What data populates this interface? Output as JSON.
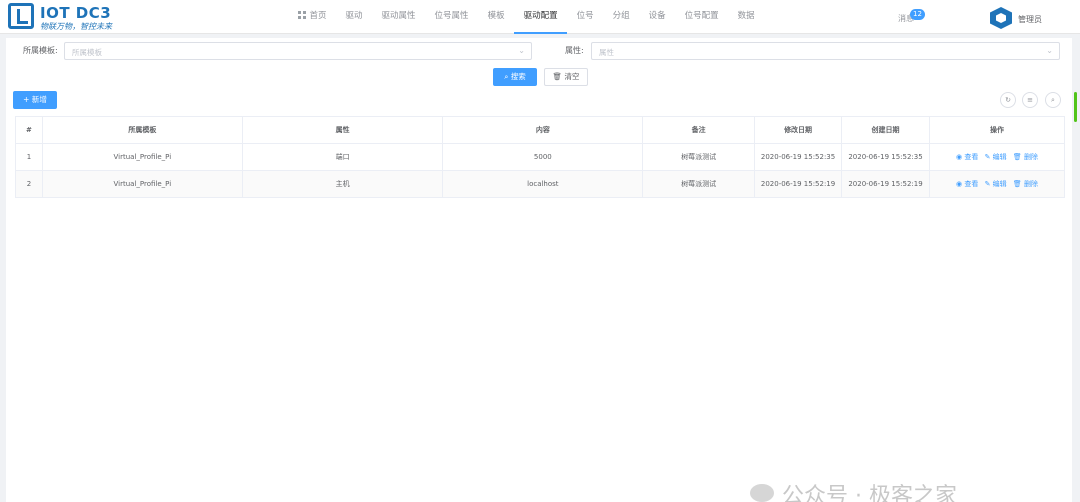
{
  "app": {
    "title": "IOT DC3",
    "subtitle": "物联万物，智控未来"
  },
  "nav": {
    "items": [
      {
        "label": "首页",
        "icon": "grid-icon"
      },
      {
        "label": "驱动"
      },
      {
        "label": "驱动属性"
      },
      {
        "label": "位号属性"
      },
      {
        "label": "模板"
      },
      {
        "label": "驱动配置",
        "active": true
      },
      {
        "label": "位号"
      },
      {
        "label": "分组"
      },
      {
        "label": "设备"
      },
      {
        "label": "位号配置"
      },
      {
        "label": "数据"
      }
    ]
  },
  "header": {
    "messages_label": "消息",
    "messages_count": "12",
    "user_name": "管理员"
  },
  "search": {
    "template_label": "所属模板:",
    "template_placeholder": "所属模板",
    "attribute_label": "属性:",
    "attribute_placeholder": "属性",
    "search_button": "搜索",
    "clear_button": "清空"
  },
  "toolbar": {
    "add_button": "+ 新增"
  },
  "table": {
    "columns": [
      "#",
      "所属模板",
      "属性",
      "内容",
      "备注",
      "修改日期",
      "创建日期",
      "操作"
    ],
    "rows": [
      {
        "index": "1",
        "template": "Virtual_Profile_Pi",
        "attribute": "端口",
        "content": "5000",
        "remark": "树莓派测试",
        "modified": "2020-06-19 15:52:35",
        "created": "2020-06-19 15:52:35"
      },
      {
        "index": "2",
        "template": "Virtual_Profile_Pi",
        "attribute": "主机",
        "content": "localhost",
        "remark": "树莓派测试",
        "modified": "2020-06-19 15:52:19",
        "created": "2020-06-19 15:52:19"
      }
    ],
    "actions": {
      "view": "查看",
      "edit": "编辑",
      "delete": "删除"
    }
  },
  "watermark": "公众号 · 极客之家",
  "colors": {
    "primary": "#409eff",
    "brand": "#1e73b8"
  }
}
